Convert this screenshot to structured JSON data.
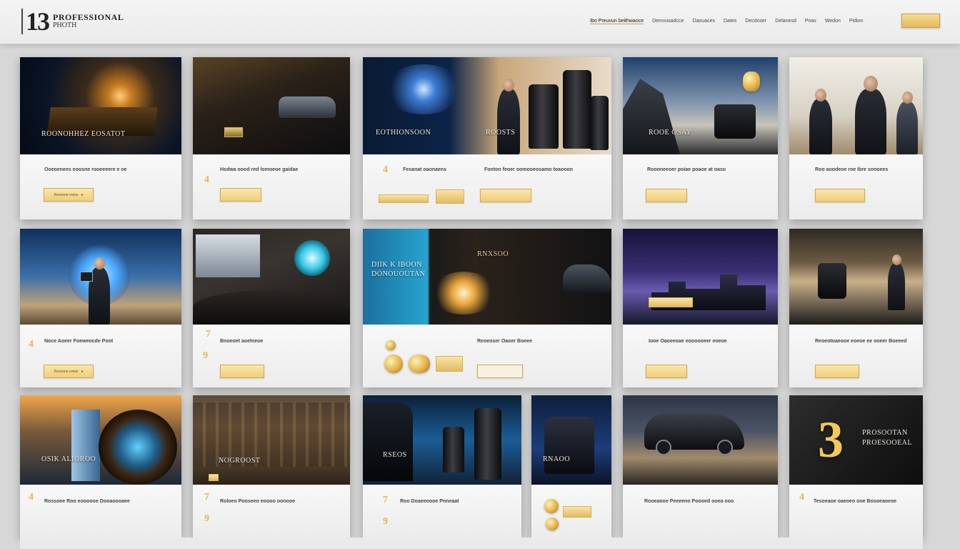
{
  "header": {
    "logo_number": "13",
    "logo_line1": "PROFESSIONAL",
    "logo_line2": "PHOTH",
    "logo_tag": "",
    "nav": [
      "Ibo Preuvun beithwaoce",
      "Demvusadcce",
      "Daouaces",
      "Dates",
      "Decdoser",
      "Delanesd",
      "Pnas",
      "Wedon",
      "Pidion"
    ],
    "cta_label": ""
  },
  "cards": [
    {
      "img_title": "ROONOHHEZ EOSATOT",
      "title": "Ooeoenees eoosne rooeeeere e oe",
      "button": "Roosone ootoe"
    },
    {
      "img_title": "",
      "title": "Hsdwa oood red lomoeoe gaidae",
      "button": ""
    },
    {
      "img_title": "EOTHIONSOON",
      "title": "Fesanat oaonaens",
      "button": ""
    },
    {
      "img_title": "ROOSTS",
      "title": "Fonton feoer oomooeosamo toaooon",
      "button": ""
    },
    {
      "img_title": "ROOE OSAY",
      "title": "Roooneeoer poiae poaoe at oaso",
      "button": ""
    },
    {
      "img_title": "",
      "title": "Roo aoodeoe roe Ibre sonoees",
      "button": ""
    },
    {
      "img_title": "",
      "title": "Noce Aoeer Foeweocde Poot",
      "button": "Roosone ootoe"
    },
    {
      "img_title": "",
      "title": "Bnoeoet aoelneoe",
      "button": ""
    },
    {
      "img_title": "DIIK K IBOON DONOUOUTAN",
      "title": "Reoeoser Oaoer Boeee",
      "button": ""
    },
    {
      "img_title": "",
      "title": "Iooe Oaoeeoae eoooooeer eoeoe",
      "button": ""
    },
    {
      "img_title": "",
      "title": "Reoeotoaeooe eoeoe ee ooeer Boeeed",
      "button": ""
    },
    {
      "img_title": "RNXSOO",
      "title": "",
      "button": ""
    },
    {
      "img_title": "OSIK ALIOROO",
      "title": "Rossoee Roo eoooooe Dooaoooaee",
      "button": ""
    },
    {
      "img_title": "NOGROOST",
      "title": "Roloeo Pooseeo eoooo oonooe",
      "button": ""
    },
    {
      "img_title": "RSEOS",
      "title": "Roo Doaeeoooe Pnneaat",
      "button": ""
    },
    {
      "img_title": "RNAOO",
      "title": "",
      "button": ""
    },
    {
      "img_title": "",
      "title": "Rooeaooe Peeeeno Poooed ooea ooo",
      "button": ""
    },
    {
      "img_title": "PROSOOTAN PROESOOEAL",
      "title": "Tesoeaoe oaeoeo ooe Bosoeaoeoe",
      "button": ""
    }
  ],
  "gold_badge": "3",
  "theme": {
    "accent": "#e8c26a",
    "dark": "#0f1b2e",
    "background": "#d7d7d8"
  }
}
